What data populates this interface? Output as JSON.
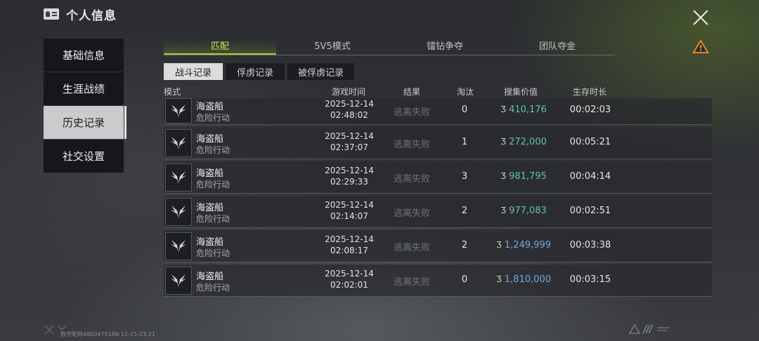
{
  "header": {
    "title": "个人信息"
  },
  "sidebar": {
    "items": [
      {
        "label": "基础信息"
      },
      {
        "label": "生涯战绩"
      },
      {
        "label": "历史记录"
      },
      {
        "label": "社交设置"
      }
    ],
    "active_index": 2
  },
  "tabs": [
    {
      "label": "匹配"
    },
    {
      "label": "5V5模式"
    },
    {
      "label": "镭钻争夺"
    },
    {
      "label": "团队夺金"
    }
  ],
  "subtabs": [
    {
      "label": "战斗记录"
    },
    {
      "label": "俘虏记录"
    },
    {
      "label": "被俘虏记录"
    }
  ],
  "table": {
    "headers": {
      "mode": "模式",
      "time": "游戏时间",
      "result": "结果",
      "kills": "淘汰",
      "value": "搜集价值",
      "survive": "生存时长"
    },
    "rows": [
      {
        "map": "海盗船",
        "mode": "危险行动",
        "date": "2025-12-14",
        "time": "02:48:02",
        "result": "逃离失败",
        "kills": "0",
        "value": "410,176",
        "survive": "00:02:03"
      },
      {
        "map": "海盗船",
        "mode": "危险行动",
        "date": "2025-12-14",
        "time": "02:37:07",
        "result": "逃离失败",
        "kills": "1",
        "value": "272,000",
        "survive": "00:05:21"
      },
      {
        "map": "海盗船",
        "mode": "危险行动",
        "date": "2025-12-14",
        "time": "02:29:33",
        "result": "逃离失败",
        "kills": "3",
        "value": "981,795",
        "survive": "00:04:14"
      },
      {
        "map": "海盗船",
        "mode": "危险行动",
        "date": "2025-12-14",
        "time": "02:14:07",
        "result": "逃离失败",
        "kills": "2",
        "value": "977,083",
        "survive": "00:02:51"
      },
      {
        "map": "海盗船",
        "mode": "危险行动",
        "date": "2025-12-14",
        "time": "02:08:17",
        "result": "逃离失败",
        "kills": "2",
        "value": "1,249,999",
        "survive": "00:03:38"
      },
      {
        "map": "海盗船",
        "mode": "危险行动",
        "date": "2025-12-14",
        "time": "02:02:01",
        "result": "逃离失败",
        "kills": "0",
        "value": "1,810,000",
        "survive": "00:03:15"
      }
    ]
  },
  "footer": {
    "watermark": "数字昵称4800475188-12-15-23:21"
  },
  "colors": {
    "accent": "#a9d036",
    "value_green": "#5fc6a0",
    "value_blue": "#72a8da",
    "warning": "#e08a2a"
  },
  "icons": [
    "id-card-icon",
    "close-icon",
    "warning-icon",
    "mode-emblem-icon",
    "coin-icon"
  ]
}
